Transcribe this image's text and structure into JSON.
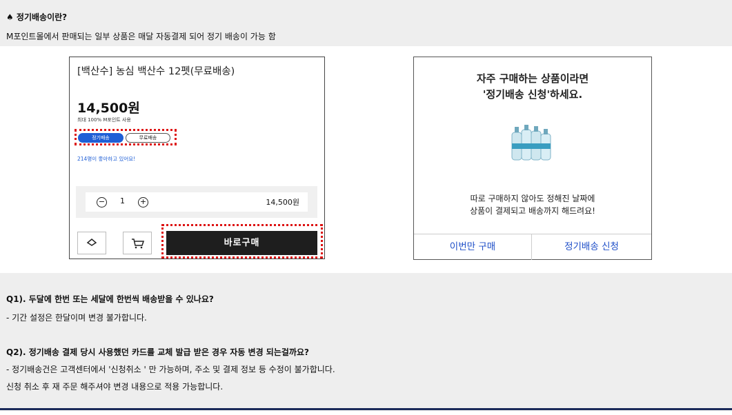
{
  "intro": {
    "title": "♠ 정기배송이란?",
    "desc": "M포인트몰에서 판매되는 일부 상품은 매달 자동결제 되어 정기 배송이 가능 함"
  },
  "product": {
    "name": "[백산수] 농심 백산수 12펫(무료배송)",
    "price": "14,500원",
    "max_use": "최대 100% M포인트 사용",
    "badge_regular": "정기배송",
    "badge_free": "무료배송",
    "likes": "214명이 좋아하고 있어요!",
    "qty_minus": "−",
    "qty_value": "1",
    "qty_plus": "+",
    "qty_price": "14,500원",
    "buy_label": "바로구매"
  },
  "popup": {
    "heading1": "자주 구매하는 상품이라면",
    "heading2": "'정기배송 신청'하세요.",
    "text1": "따로 구매하지 않아도 정해진 날짜에",
    "text2": "상품이 결제되고 배송까지 해드려요!",
    "btn_once": "이번만 구매",
    "btn_subscribe": "정기배송 신청"
  },
  "faq": [
    {
      "q": "Q1). 두달에 한번 또는 세달에 한번씩 배송받을 수 있나요?",
      "a": [
        "- 기간 설정은 한달이며 변경 불가합니다."
      ]
    },
    {
      "q": "Q2). 정기배송 결제 당시 사용했던 카드를 교체 발급 받은 경우 자동 변경 되는걸까요?",
      "a": [
        "- 정기배송건은 고객센터에서 '신청취소 ' 만 가능하며, 주소 및 결제 정보 등 수정이 불가합니다.",
        "신청 취소 후 재 주문 해주셔야 변경 내용으로 적용 가능합니다."
      ]
    }
  ],
  "colors": {
    "accent": "#1f5fd6",
    "highlight": "#dd1111",
    "panel": "#eeeeee"
  }
}
